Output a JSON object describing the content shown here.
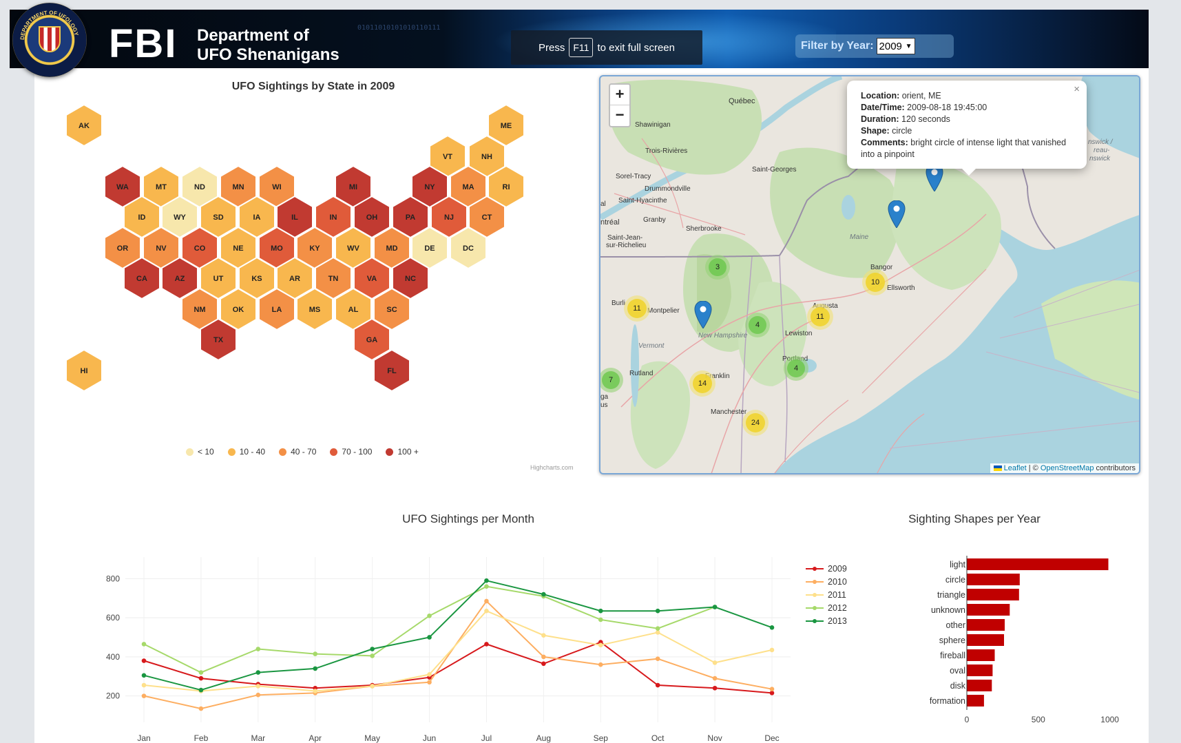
{
  "header": {
    "agency": "FBI",
    "dept_line1": "Department of",
    "dept_line2": "UFO Shenanigans",
    "fullscreen_pre": "Press",
    "fullscreen_key": "F11",
    "fullscreen_post": "to exit full screen",
    "filter_label": "Filter by Year:",
    "filter_value": "2009",
    "binary_text": "01011010101010110111",
    "seal_text": "DEPARTMENT OF UFOLOGY"
  },
  "hexmap": {
    "title": "UFO Sightings by State in 2009",
    "credits": "Highcharts.com",
    "legend": [
      {
        "label": "< 10",
        "color": "#f7e7ac"
      },
      {
        "label": "10 - 40",
        "color": "#f8b74e"
      },
      {
        "label": "40 - 70",
        "color": "#f39046"
      },
      {
        "label": "70 - 100",
        "color": "#e05b3a"
      },
      {
        "label": "100 +",
        "color": "#c13a31"
      }
    ],
    "states": [
      {
        "code": "AK",
        "bin": 1
      },
      {
        "code": "ME",
        "bin": 1
      },
      {
        "code": "VT",
        "bin": 1
      },
      {
        "code": "NH",
        "bin": 1
      },
      {
        "code": "WA",
        "bin": 4
      },
      {
        "code": "MT",
        "bin": 1
      },
      {
        "code": "ND",
        "bin": 0
      },
      {
        "code": "MN",
        "bin": 2
      },
      {
        "code": "WI",
        "bin": 2
      },
      {
        "code": "MI",
        "bin": 4
      },
      {
        "code": "NY",
        "bin": 4
      },
      {
        "code": "MA",
        "bin": 2
      },
      {
        "code": "RI",
        "bin": 1
      },
      {
        "code": "ID",
        "bin": 1
      },
      {
        "code": "WY",
        "bin": 0
      },
      {
        "code": "SD",
        "bin": 1
      },
      {
        "code": "IA",
        "bin": 1
      },
      {
        "code": "IL",
        "bin": 4
      },
      {
        "code": "IN",
        "bin": 3
      },
      {
        "code": "OH",
        "bin": 4
      },
      {
        "code": "PA",
        "bin": 4
      },
      {
        "code": "NJ",
        "bin": 3
      },
      {
        "code": "CT",
        "bin": 2
      },
      {
        "code": "OR",
        "bin": 2
      },
      {
        "code": "NV",
        "bin": 2
      },
      {
        "code": "CO",
        "bin": 3
      },
      {
        "code": "NE",
        "bin": 1
      },
      {
        "code": "MO",
        "bin": 3
      },
      {
        "code": "KY",
        "bin": 2
      },
      {
        "code": "WV",
        "bin": 1
      },
      {
        "code": "MD",
        "bin": 2
      },
      {
        "code": "DE",
        "bin": 0
      },
      {
        "code": "DC",
        "bin": 0
      },
      {
        "code": "CA",
        "bin": 4
      },
      {
        "code": "AZ",
        "bin": 4
      },
      {
        "code": "UT",
        "bin": 1
      },
      {
        "code": "KS",
        "bin": 1
      },
      {
        "code": "AR",
        "bin": 1
      },
      {
        "code": "TN",
        "bin": 2
      },
      {
        "code": "VA",
        "bin": 3
      },
      {
        "code": "NC",
        "bin": 4
      },
      {
        "code": "NM",
        "bin": 2
      },
      {
        "code": "OK",
        "bin": 1
      },
      {
        "code": "LA",
        "bin": 2
      },
      {
        "code": "MS",
        "bin": 1
      },
      {
        "code": "AL",
        "bin": 1
      },
      {
        "code": "SC",
        "bin": 2
      },
      {
        "code": "TX",
        "bin": 4
      },
      {
        "code": "GA",
        "bin": 3
      },
      {
        "code": "HI",
        "bin": 1
      },
      {
        "code": "FL",
        "bin": 4
      }
    ]
  },
  "map": {
    "zoom_in": "+",
    "zoom_out": "−",
    "popup": {
      "location_label": "Location:",
      "location": "orient, ME",
      "datetime_label": "Date/Time:",
      "datetime": "2009-08-18 19:45:00",
      "duration_label": "Duration:",
      "duration": "120 seconds",
      "shape_label": "Shape:",
      "shape": "circle",
      "comments_label": "Comments:",
      "comments": "bright circle of intense light that vanished into a pinpoint",
      "close": "×"
    },
    "attribution": {
      "leaflet": "Leaflet",
      "sep": " | © ",
      "osm": "OpenStreetMap",
      "suffix": " contributors"
    },
    "cities": [
      "Québec",
      "Shawinigan",
      "Trois-Rivières",
      "Saint-Georges",
      "Sorel-Tracy",
      "Drummondville",
      "Saint-Hyacinthe",
      "Granby",
      "ntréal",
      "Sherbrooke",
      "Saint-Jean-",
      "sur-Richelieu",
      "Maine",
      "Bangor",
      "Ellsworth",
      "Burli",
      "Montpelier",
      "Augusta",
      "Lewiston",
      "Vermont",
      "New Hampshire",
      "Portland",
      "Rutland",
      "Franklin",
      "Manchester",
      "al",
      "ga",
      "us",
      "nswick /",
      "reau-",
      "nswick"
    ],
    "clusters": [
      {
        "count": "3",
        "color": "green"
      },
      {
        "count": "10",
        "color": "yellow"
      },
      {
        "count": "11",
        "color": "yellow"
      },
      {
        "count": "11",
        "color": "yellow"
      },
      {
        "count": "4",
        "color": "green"
      },
      {
        "count": "4",
        "color": "green"
      },
      {
        "count": "7",
        "color": "green"
      },
      {
        "count": "14",
        "color": "yellow"
      },
      {
        "count": "24",
        "color": "yellow"
      }
    ]
  },
  "chart_data": [
    {
      "type": "line",
      "title": "UFO Sightings per Month",
      "categories": [
        "Jan",
        "Feb",
        "Mar",
        "Apr",
        "May",
        "Jun",
        "Jul",
        "Aug",
        "Sep",
        "Oct",
        "Nov",
        "Dec"
      ],
      "yticks": [
        200,
        400,
        600,
        800
      ],
      "ylim": [
        100,
        840
      ],
      "grid": true,
      "legend_position": "right",
      "series": [
        {
          "name": "2009",
          "color": "#d7191c",
          "values": [
            380,
            290,
            260,
            240,
            255,
            295,
            465,
            365,
            475,
            255,
            240,
            215
          ]
        },
        {
          "name": "2010",
          "color": "#fdae61",
          "values": [
            200,
            135,
            205,
            215,
            250,
            270,
            685,
            400,
            360,
            390,
            290,
            235
          ]
        },
        {
          "name": "2011",
          "color": "#fee08b",
          "values": [
            255,
            225,
            250,
            225,
            250,
            310,
            635,
            510,
            460,
            525,
            370,
            435
          ]
        },
        {
          "name": "2012",
          "color": "#a6d96a",
          "values": [
            465,
            320,
            440,
            415,
            405,
            610,
            760,
            710,
            590,
            545,
            655,
            null
          ]
        },
        {
          "name": "2013",
          "color": "#1a9641",
          "values": [
            305,
            230,
            320,
            340,
            440,
            500,
            790,
            720,
            635,
            635,
            655,
            550
          ]
        }
      ]
    },
    {
      "type": "bar",
      "orientation": "horizontal",
      "title": "Sighting Shapes per Year",
      "categories": [
        "light",
        "circle",
        "triangle",
        "unknown",
        "other",
        "sphere",
        "fireball",
        "oval",
        "disk",
        "formation"
      ],
      "values": [
        990,
        370,
        365,
        300,
        265,
        260,
        195,
        180,
        175,
        120
      ],
      "xticks": [
        0,
        500,
        1000
      ],
      "xlim": [
        0,
        1050
      ],
      "color": "#c00000"
    }
  ]
}
